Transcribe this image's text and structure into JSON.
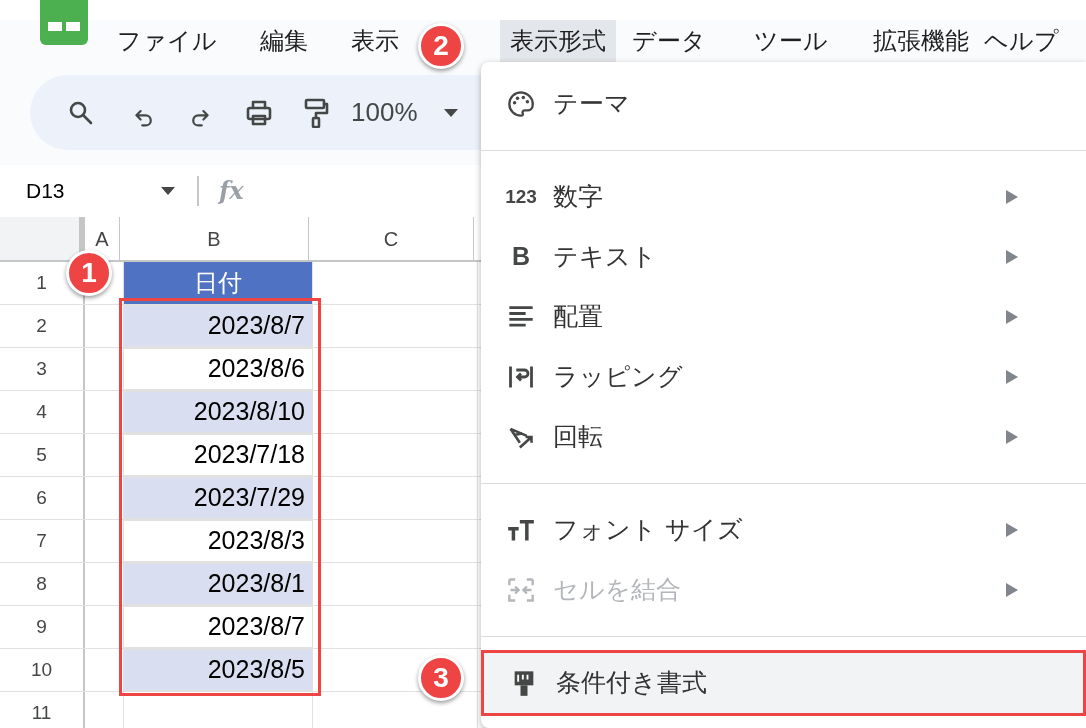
{
  "menu_bar": [
    {
      "label": "ファイル",
      "selected": false
    },
    {
      "label": "編集",
      "selected": false
    },
    {
      "label": "表示",
      "selected": false
    },
    {
      "label": "表示形式",
      "selected": true
    },
    {
      "label": "データ",
      "selected": false
    },
    {
      "label": "ツール",
      "selected": false
    },
    {
      "label": "拡張機能",
      "selected": false
    },
    {
      "label": "ヘルプ",
      "selected": false
    }
  ],
  "toolbar": {
    "zoom": "100%"
  },
  "formula_bar": {
    "name_box": "D13",
    "fx": "fx"
  },
  "sheet": {
    "columns": [
      "A",
      "B",
      "C"
    ],
    "rows": [
      {
        "number": "1",
        "kind": "header",
        "value": "日付"
      },
      {
        "number": "2",
        "kind": "shaded",
        "value": "2023/8/7"
      },
      {
        "number": "3",
        "kind": "plain",
        "value": "2023/8/6"
      },
      {
        "number": "4",
        "kind": "shaded",
        "value": "2023/8/10"
      },
      {
        "number": "5",
        "kind": "plain",
        "value": "2023/7/18"
      },
      {
        "number": "6",
        "kind": "shaded",
        "value": "2023/7/29"
      },
      {
        "number": "7",
        "kind": "plain",
        "value": "2023/8/3"
      },
      {
        "number": "8",
        "kind": "shaded",
        "value": "2023/8/1"
      },
      {
        "number": "9",
        "kind": "plain",
        "value": "2023/8/7"
      },
      {
        "number": "10",
        "kind": "shaded",
        "value": "2023/8/5"
      },
      {
        "number": "11",
        "kind": "empty",
        "value": ""
      }
    ]
  },
  "dropdown": {
    "sections": [
      [
        {
          "label": "テーマ",
          "submenu": false,
          "disabled": false,
          "highlighted": false
        }
      ],
      [
        {
          "label": "数字",
          "icon_glyph": "123",
          "submenu": true,
          "disabled": false,
          "highlighted": false
        },
        {
          "label": "テキスト",
          "icon_glyph": "B",
          "submenu": true,
          "disabled": false,
          "highlighted": false
        },
        {
          "label": "配置",
          "submenu": true,
          "disabled": false,
          "highlighted": false
        },
        {
          "label": "ラッピング",
          "submenu": true,
          "disabled": false,
          "highlighted": false
        },
        {
          "label": "回転",
          "submenu": true,
          "disabled": false,
          "highlighted": false
        }
      ],
      [
        {
          "label": "フォント サイズ",
          "submenu": true,
          "disabled": false,
          "highlighted": false
        },
        {
          "label": "セルを結合",
          "submenu": true,
          "disabled": true,
          "highlighted": false
        }
      ],
      [
        {
          "label": "条件付き書式",
          "submenu": false,
          "disabled": false,
          "highlighted": true
        }
      ]
    ]
  },
  "annotations": {
    "badges": [
      "1",
      "2",
      "3"
    ]
  }
}
